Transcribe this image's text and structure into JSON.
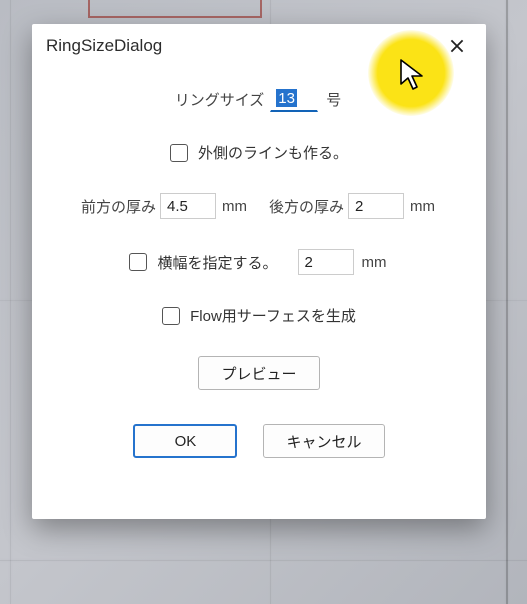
{
  "window": {
    "title": "RingSizeDialog"
  },
  "ringSize": {
    "label": "リングサイズ",
    "value": "13",
    "unit": "号"
  },
  "outerLine": {
    "label": "外側のラインも作る。",
    "checked": false
  },
  "thickness": {
    "front": {
      "label": "前方の厚み",
      "value": "4.5",
      "unit": "mm"
    },
    "back": {
      "label": "後方の厚み",
      "value": "2",
      "unit": "mm"
    }
  },
  "width": {
    "label": "横幅を指定する。",
    "checked": false,
    "value": "2",
    "unit": "mm"
  },
  "flowSurface": {
    "label": "Flow用サーフェスを生成",
    "checked": false
  },
  "buttons": {
    "preview": "プレビュー",
    "ok": "OK",
    "cancel": "キャンセル"
  }
}
